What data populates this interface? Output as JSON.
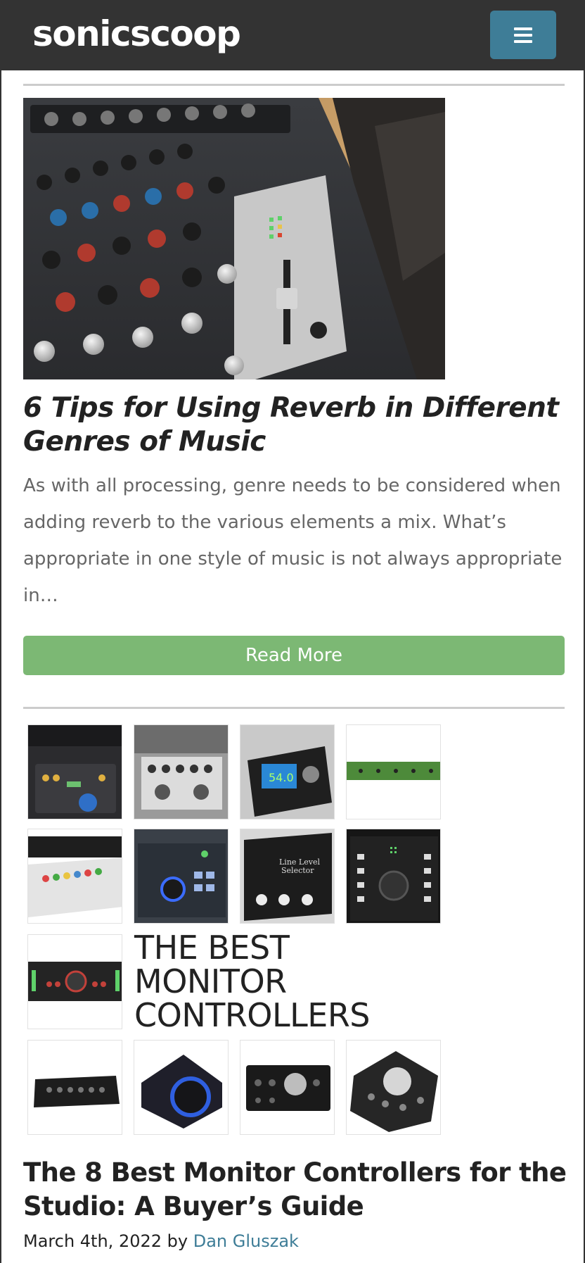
{
  "header": {
    "logo": "sonicscoop",
    "menu_icon": "hamburger-menu-icon",
    "bg_color": "#333333",
    "menu_color": "#3e7d97"
  },
  "post1": {
    "image": "audio-mixer-photo",
    "title": "6 Tips for Using Reverb in Different Genres of Music",
    "excerpt": "As with all processing, genre needs to be considered when adding reverb to the various elements a mix. What’s appropriate in one style of music is not always appropriate in…",
    "read_more": "Read More",
    "button_color": "#7cb874"
  },
  "post2": {
    "collage_text": [
      "THE BEST",
      "MONITOR",
      "CONTROLLERS"
    ],
    "title": "The 8 Best Monitor Controllers for the Studio: A Buyer’s Guide",
    "date": "March 4th, 2022",
    "by": "by",
    "author": "Dan Gluszak",
    "link_color": "#3e7d97"
  }
}
